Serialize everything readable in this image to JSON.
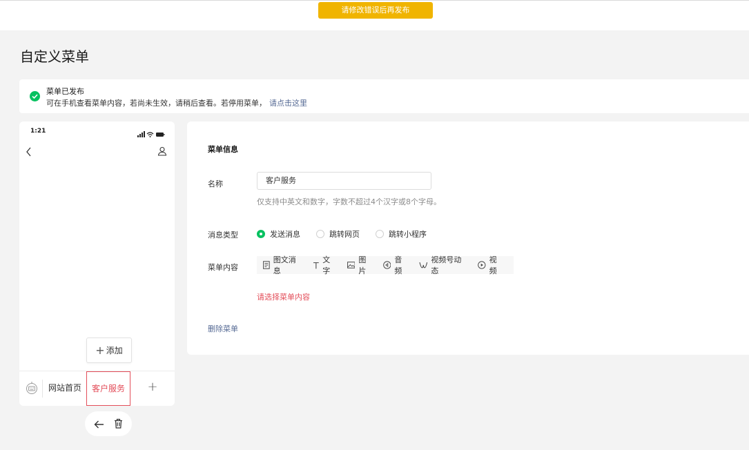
{
  "top_warning": "请修改错误后再发布",
  "page_title": "自定义菜单",
  "notice": {
    "title": "菜单已发布",
    "description": "可在手机查看菜单内容，若尚未生效，请稍后查看。若停用菜单，",
    "link": "请点击这里"
  },
  "phone": {
    "time": "1:21",
    "add_label": "添加",
    "menu_items": [
      "网站首页",
      "客户服务"
    ],
    "add_symbol": "+"
  },
  "panel": {
    "title": "菜单信息",
    "name_label": "名称",
    "name_value": "客户服务",
    "name_hint": "仅支持中英文和数字，字数不超过4个汉字或8个字母。",
    "msg_type_label": "消息类型",
    "msg_types": [
      {
        "label": "发送消息",
        "selected": true
      },
      {
        "label": "跳转网页",
        "selected": false
      },
      {
        "label": "跳转小程序",
        "selected": false
      }
    ],
    "content_label": "菜单内容",
    "content_types": [
      "图文消息",
      "文字",
      "图片",
      "音频",
      "视频号动态",
      "视频"
    ],
    "error": "请选择菜单内容",
    "delete": "删除菜单"
  },
  "colors": {
    "warning": "#f0b400",
    "success": "#07c160",
    "error": "#e34d59",
    "link": "#576b95"
  }
}
